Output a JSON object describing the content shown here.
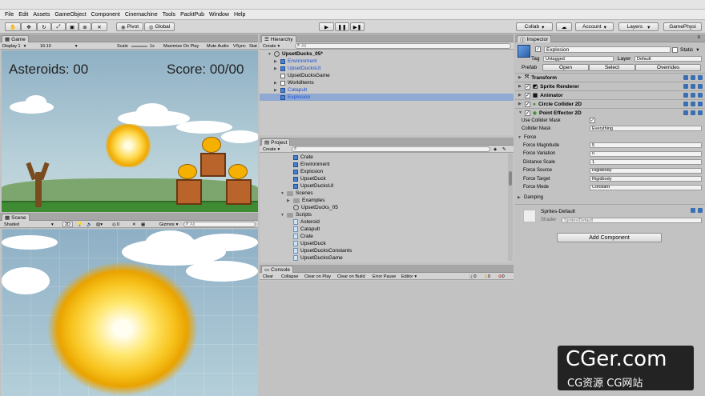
{
  "menu": [
    "File",
    "Edit",
    "Assets",
    "GameObject",
    "Component",
    "Cinemachine",
    "Tools",
    "PacktPub",
    "Window",
    "Help"
  ],
  "toolbar": {
    "pivot": "Pivot",
    "global": "Global",
    "collab": "Collab",
    "account": "Account",
    "layers": "Layers",
    "layout": "GamePhysi"
  },
  "game": {
    "tab": "Game",
    "display": "Display 1",
    "aspect": "16:10",
    "scale_label": "Scale",
    "scale_value": "1x",
    "maximize": "Maximize On Play",
    "mute": "Mute Audio",
    "vsync": "VSync",
    "stats": "Stat",
    "asteroids": "Asteroids: 00",
    "score": "Score: 00/00"
  },
  "scene": {
    "tab": "Scene",
    "shading": "Shaded",
    "mode2d": "2D",
    "gizmos": "Gizmos",
    "search_placeholder": "All",
    "count": "0"
  },
  "hierarchy": {
    "tab": "Hierarchy",
    "create": "Create",
    "search_placeholder": "All",
    "root": "UpsetDucks_05*",
    "items": [
      {
        "label": "Environment",
        "blue": true,
        "arrow": true,
        "selected": false
      },
      {
        "label": "UpsetDucksUI",
        "blue": true,
        "arrow": true,
        "selected": false
      },
      {
        "label": "UpsetDucksGame",
        "blue": false,
        "arrow": false,
        "selected": false
      },
      {
        "label": "WorldItems",
        "blue": false,
        "arrow": true,
        "selected": false
      },
      {
        "label": "Catapult",
        "blue": true,
        "arrow": true,
        "selected": false
      },
      {
        "label": "Explosion",
        "blue": true,
        "arrow": false,
        "selected": true
      }
    ]
  },
  "project": {
    "tab": "Project",
    "create": "Create",
    "search_placeholder": "",
    "items": [
      {
        "label": "Crate",
        "icon": "prefab",
        "indent": 2
      },
      {
        "label": "Environment",
        "icon": "prefab",
        "indent": 2
      },
      {
        "label": "Explosion",
        "icon": "prefab",
        "indent": 2
      },
      {
        "label": "UpsetDuck",
        "icon": "prefab",
        "indent": 2
      },
      {
        "label": "UpsetDucksUI",
        "icon": "prefab",
        "indent": 2
      },
      {
        "label": "Scenes",
        "icon": "folder",
        "indent": 1,
        "open": true
      },
      {
        "label": "Examples",
        "icon": "folder",
        "indent": 2,
        "open": false
      },
      {
        "label": "UpsetDucks_05",
        "icon": "scene",
        "indent": 2
      },
      {
        "label": "Scripts",
        "icon": "folder",
        "indent": 1,
        "open": true
      },
      {
        "label": "Asteroid",
        "icon": "script",
        "indent": 2
      },
      {
        "label": "Catapult",
        "icon": "script",
        "indent": 2
      },
      {
        "label": "Crate",
        "icon": "script",
        "indent": 2
      },
      {
        "label": "UpsetDuck",
        "icon": "script",
        "indent": 2
      },
      {
        "label": "UpsetDucksConstants",
        "icon": "script",
        "indent": 2
      },
      {
        "label": "UpsetDucksGame",
        "icon": "script",
        "indent": 2
      }
    ]
  },
  "console": {
    "tab": "Console",
    "buttons": [
      "Clear",
      "Collapse",
      "Clear on Play",
      "Clear on Build",
      "Error Pause",
      "Editor"
    ],
    "counts": [
      "0",
      "0",
      "0"
    ]
  },
  "inspector": {
    "tab": "Inspector",
    "object_name": "Explosion",
    "static_label": "Static",
    "tag_label": "Tag",
    "tag_value": "Untagged",
    "layer_label": "Layer",
    "layer_value": "Default",
    "prefab_label": "Prefab",
    "prefab_open": "Open",
    "prefab_select": "Select",
    "prefab_overrides": "Overrides",
    "components": [
      "Transform",
      "Sprite Renderer",
      "Animator",
      "Circle Collider 2D",
      "Point Effector 2D"
    ],
    "use_collider_mask": "Use Collider Mask",
    "collider_mask_label": "Collider Mask",
    "collider_mask_value": "Everything",
    "force_section": "Force",
    "props": [
      {
        "label": "Force Magnitude",
        "value": "5"
      },
      {
        "label": "Force Variation",
        "value": "0"
      },
      {
        "label": "Distance Scale",
        "value": "1"
      },
      {
        "label": "Force Source",
        "value": "Rigidbody"
      },
      {
        "label": "Force Target",
        "value": "Rigidbody"
      },
      {
        "label": "Force Mode",
        "value": "Constant"
      }
    ],
    "damping": "Damping",
    "material_name": "Sprites-Default",
    "shader_label": "Shader",
    "shader_value": "Sprites/Default",
    "add_component": "Add Component"
  },
  "watermark": {
    "main": "CGer.com",
    "sub": "CG资源 CG网站"
  }
}
